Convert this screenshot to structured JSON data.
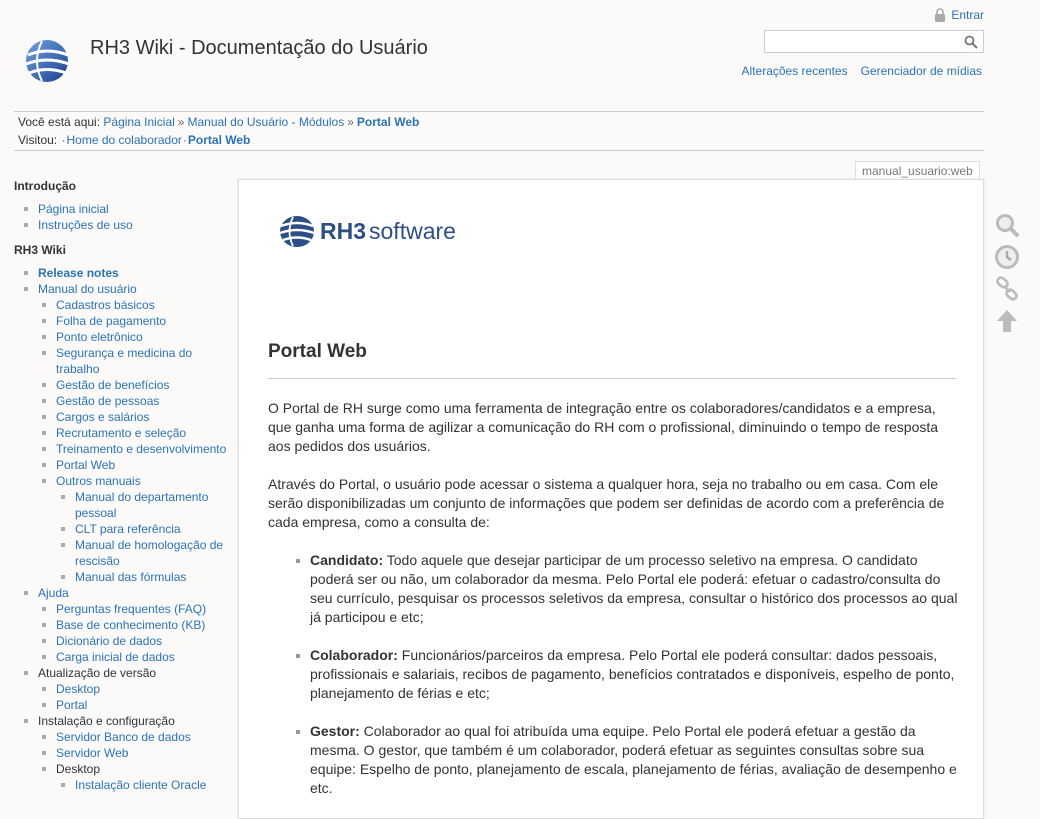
{
  "header": {
    "title": "RH3 Wiki - Documentação do Usuário",
    "login_label": "Entrar",
    "search_value": "",
    "links": [
      "Alterações recentes",
      "Gerenciador de mídias"
    ]
  },
  "breadcrumbs": {
    "here_label": "Você está aqui:",
    "here": [
      "Página Inicial",
      "Manual do Usuário - Módulos",
      "Portal Web"
    ],
    "visited_label": "Visitou:",
    "visited": [
      "Home do colaborador",
      "Portal Web"
    ]
  },
  "sidebar": {
    "section1_title": "Introdução",
    "section1_items": [
      "Página inicial",
      "Instruções de uso"
    ],
    "section2_title": "RH3 Wiki",
    "release_notes": "Release notes",
    "manual": "Manual do usuário",
    "manual_items": [
      "Cadastros básicos",
      "Folha de pagamento",
      "Ponto eletrônico",
      "Segurança e medicina do trabalho",
      "Gestão de benefícios",
      "Gestão de pessoas",
      "Cargos e salários",
      "Recrutamento e seleção",
      "Treinamento e desenvolvimento",
      "Portal Web",
      "Outros manuais"
    ],
    "outros_items": [
      "Manual do departamento pessoal",
      "CLT para referência",
      "Manual de homologação de rescisão",
      "Manual das fórmulas"
    ],
    "ajuda": "Ajuda",
    "ajuda_items": [
      "Perguntas frequentes (FAQ)",
      "Base de conhecimento (KB)",
      "Dicionário de dados",
      "Carga inicial de dados"
    ],
    "atualizacao": "Atualização de versão",
    "atualizacao_items": [
      "Desktop",
      "Portal"
    ],
    "instalacao": "Instalação e configuração",
    "instalacao_items": [
      "Servidor Banco de dados",
      "Servidor Web"
    ],
    "desktop": "Desktop",
    "desktop_items": [
      "Instalação cliente Oracle"
    ]
  },
  "page": {
    "id": "manual_usuario:web",
    "brand_bold": "RH3",
    "brand_rest": "software",
    "heading": "Portal Web",
    "paragraphs": [
      "O Portal de RH surge como uma ferramenta de integração entre os colaboradores/candidatos e a empresa, que ganha uma forma de agilizar a comunicação do RH com o profissional, diminuindo o tempo de resposta aos pedidos dos usuários.",
      "Através do Portal, o usuário pode acessar o sistema a qualquer hora, seja no trabalho ou em casa. Com ele serão disponibilizadas um conjunto de informações que podem ser definidas de acordo com a preferência de cada empresa, como a consulta de:"
    ],
    "items": [
      {
        "term": "Candidato:",
        "text": " Todo aquele que desejar participar de um processo seletivo na empresa. O candidato poderá ser ou não, um colaborador da mesma. Pelo Portal ele poderá: efetuar o cadastro/consulta do seu currículo, pesquisar os processos seletivos da empresa, consultar o histórico dos processos ao qual já participou e etc;"
      },
      {
        "term": "Colaborador:",
        "text": " Funcionários/parceiros da empresa. Pelo Portal ele poderá consultar: dados pessoais, profissionais e salariais, recibos de pagamento, benefícios contratados e disponíveis, espelho de ponto, planejamento de férias e etc;"
      },
      {
        "term": "Gestor:",
        "text": " Colaborador ao qual foi atribuída uma equipe. Pelo Portal ele poderá efetuar a gestão da mesma. O gestor, que também é um colaborador, poderá efetuar as seguintes consultas sobre sua equipe: Espelho de ponto, planejamento de escala, planejamento de férias, avaliação de desempenho e etc."
      }
    ]
  },
  "tools": [
    "search-icon",
    "revisions-icon",
    "backlinks-icon",
    "back-to-top-icon"
  ],
  "colors": {
    "link": "#2b73b7",
    "brand": "#2d4e86",
    "background": "#fbfaf9"
  }
}
